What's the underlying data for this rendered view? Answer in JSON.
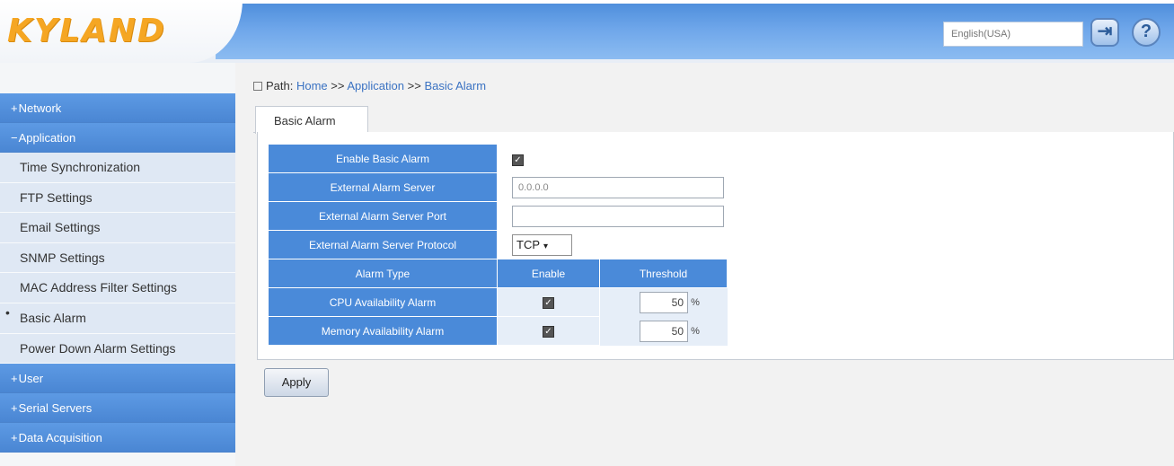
{
  "header": {
    "logo": "KYLAND",
    "language": "English(USA)",
    "logout_icon": "logout-icon",
    "help_icon": "help-icon",
    "help_glyph": "?"
  },
  "sidebar": {
    "groups_before": [
      {
        "sign": "+",
        "label": "Network"
      },
      {
        "sign": "−",
        "label": "Application"
      }
    ],
    "items": [
      {
        "label": "Time Synchronization"
      },
      {
        "label": "FTP Settings"
      },
      {
        "label": "Email Settings"
      },
      {
        "label": "SNMP Settings"
      },
      {
        "label": "MAC Address Filter Settings"
      },
      {
        "label": "Basic Alarm"
      },
      {
        "label": "Power Down Alarm Settings"
      }
    ],
    "groups_after": [
      {
        "sign": "+",
        "label": "User"
      },
      {
        "sign": "+",
        "label": "Serial Servers"
      },
      {
        "sign": "+",
        "label": "Data Acquisition"
      }
    ]
  },
  "breadcrumb": {
    "prefix": "Path:",
    "home": "Home",
    "sep1": ">>",
    "section": "Application",
    "sep2": ">>",
    "page": "Basic Alarm"
  },
  "tab": {
    "label": "Basic Alarm"
  },
  "form": {
    "enable_basic_alarm_label": "Enable Basic Alarm",
    "external_server_label": "External Alarm Server",
    "external_server_value": "0.0.0.0",
    "external_port_label": "External Alarm Server Port",
    "external_port_value": "",
    "external_protocol_label": "External Alarm Server Protocol",
    "external_protocol_value": "TCP",
    "col_alarm_type": "Alarm Type",
    "col_enable": "Enable",
    "col_threshold": "Threshold",
    "rows": [
      {
        "label": "CPU Availability Alarm",
        "threshold": "50",
        "unit": "%"
      },
      {
        "label": "Memory Availability Alarm",
        "threshold": "50",
        "unit": "%"
      }
    ]
  },
  "apply_label": "Apply"
}
